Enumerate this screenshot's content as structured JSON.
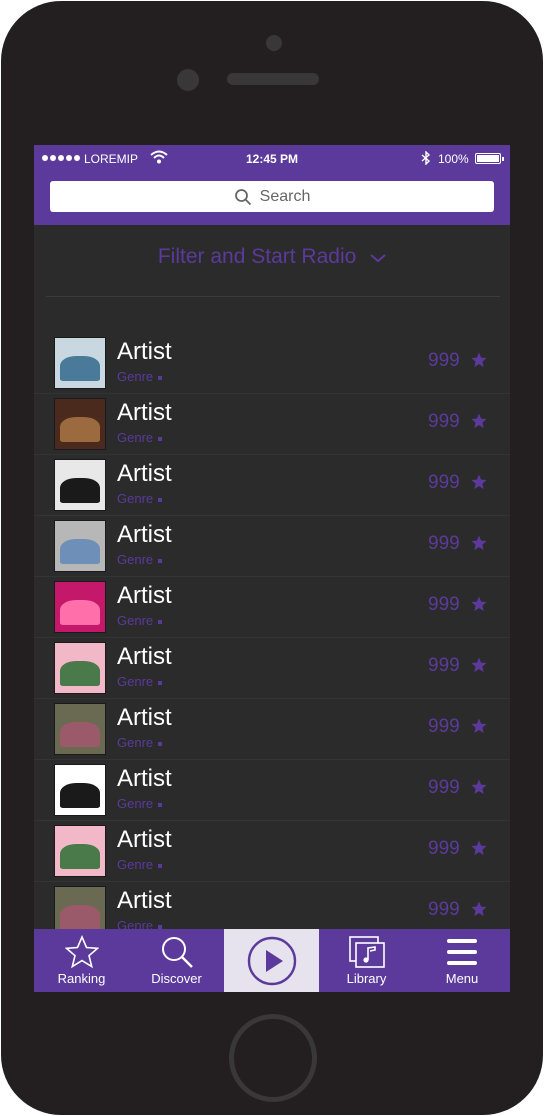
{
  "status": {
    "carrier": "LOREMIP",
    "time": "12:45 PM",
    "battery": "100%"
  },
  "search": {
    "label": "Search"
  },
  "filter": {
    "label": "Filter and Start Radio"
  },
  "artists": [
    {
      "name": "Artist",
      "genre": "Genre",
      "count": "999",
      "a": "#c9d8e0",
      "b": "#4a7a9a"
    },
    {
      "name": "Artist",
      "genre": "Genre",
      "count": "999",
      "a": "#4b2a1e",
      "b": "#9b6a3e"
    },
    {
      "name": "Artist",
      "genre": "Genre",
      "count": "999",
      "a": "#e8e8e8",
      "b": "#1a1a1a"
    },
    {
      "name": "Artist",
      "genre": "Genre",
      "count": "999",
      "a": "#b7b7b7",
      "b": "#6d8fb8"
    },
    {
      "name": "Artist",
      "genre": "Genre",
      "count": "999",
      "a": "#c4186a",
      "b": "#ff6fa9"
    },
    {
      "name": "Artist",
      "genre": "Genre",
      "count": "999",
      "a": "#f2b8c8",
      "b": "#4a7a4a"
    },
    {
      "name": "Artist",
      "genre": "Genre",
      "count": "999",
      "a": "#6a6a52",
      "b": "#9b5a6a"
    },
    {
      "name": "Artist",
      "genre": "Genre",
      "count": "999",
      "a": "#ffffff",
      "b": "#1a1a1a"
    },
    {
      "name": "Artist",
      "genre": "Genre",
      "count": "999",
      "a": "#f2b8c8",
      "b": "#4a7a4a"
    },
    {
      "name": "Artist",
      "genre": "Genre",
      "count": "999",
      "a": "#6a6a52",
      "b": "#9b5a6a"
    }
  ],
  "tabs": {
    "ranking": "Ranking",
    "discover": "Discover",
    "library": "Library",
    "menu": "Menu"
  },
  "colors": {
    "accent": "#5b3a9b",
    "background": "#2b2b2b",
    "play_tab": "#e6e3ee"
  }
}
